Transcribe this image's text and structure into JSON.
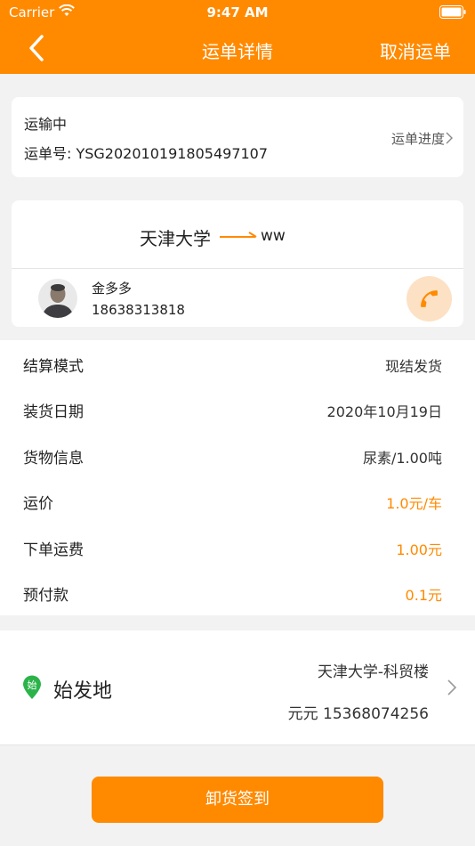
{
  "status_bar": {
    "carrier": "Carrier",
    "time": "9:47 AM"
  },
  "nav": {
    "title": "运单详情",
    "cancel_label": "取消运单",
    "back_icon": "chevron-left-icon"
  },
  "status_card": {
    "status": "运输中",
    "order_number": "运单号: YSG202010191805497107",
    "progress_link": "运单进度"
  },
  "route": {
    "from": "天津大学",
    "to": "ww",
    "driver": {
      "name": "金多多",
      "phone": "18638313818"
    }
  },
  "info_rows": [
    {
      "label": "结算模式",
      "value": "现结发货",
      "highlight": false
    },
    {
      "label": "装货日期",
      "value": "2020年10月19日",
      "highlight": false
    },
    {
      "label": "货物信息",
      "value": "尿素/1.00吨",
      "highlight": false
    },
    {
      "label": "运价",
      "value": "1.0元/车",
      "highlight": true
    },
    {
      "label": "下单运费",
      "value": "1.00元",
      "highlight": true
    },
    {
      "label": "预付款",
      "value": "0.1元",
      "highlight": true
    }
  ],
  "origin": {
    "pin_label": "始",
    "label": "始发地",
    "address": "天津大学-科贸楼",
    "contact": "元元 15368074256"
  },
  "actions": {
    "unload_label": "卸货签到"
  },
  "colors": {
    "accent": "#ff8a00",
    "call_bg": "#fde1c4",
    "origin_pin": "#2bb34a"
  }
}
